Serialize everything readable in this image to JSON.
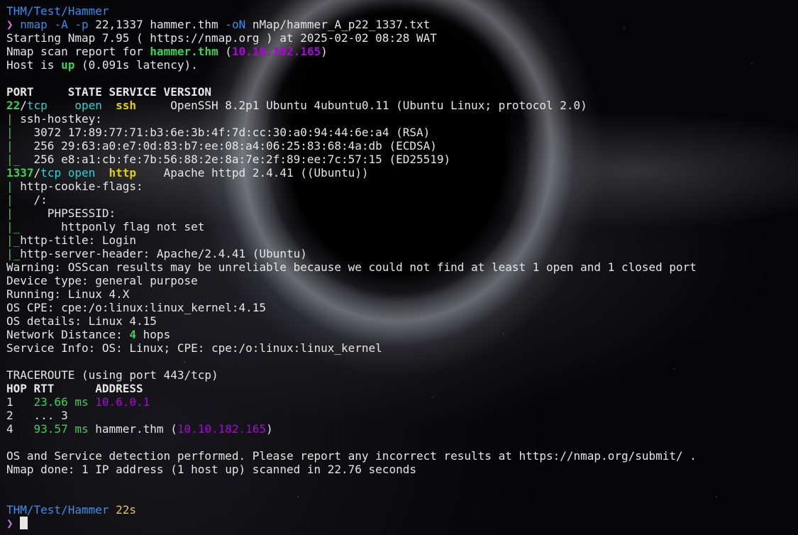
{
  "prompt_top": {
    "path": "THM/Test/Hammer",
    "symbol": "❯"
  },
  "command": {
    "exe": "nmap",
    "flag_A": "-A",
    "flag_p": "-p",
    "ports": "22,1337",
    "host": "hammer.thm",
    "flag_oN": "-oN",
    "outfile": "nMap/hammer_A_p22_1337.txt"
  },
  "output": {
    "starting": "Starting Nmap 7.95 ( https://nmap.org ) at 2025-02-02 08:28 WAT",
    "report_prefix": "Nmap scan report for ",
    "report_host": "hammer.thm",
    "report_paren_open": " (",
    "report_ip": "10.10.182.165",
    "report_paren_close": ")",
    "host_is": "Host is ",
    "host_up": "up",
    "latency": " (0.091s latency).",
    "header": "PORT     STATE SERVICE VERSION",
    "port22_num": "22",
    "port22_slash": "/",
    "port22_proto": "tcp",
    "port22_gap1": "    ",
    "port22_state": "open",
    "port22_gap2": "  ",
    "port22_service": "ssh",
    "port22_version": "     OpenSSH 8.2p1 Ubuntu 4ubuntu0.11 (Ubuntu Linux; protocol 2.0)",
    "hostkey_bar": "|",
    "hostkey_title": " ssh-hostkey: ",
    "hostkey_1_bar": "|",
    "hostkey_1": "   3072 17:89:77:71:b3:6e:3b:4f:7d:cc:30:a0:94:44:6e:a4 (RSA)",
    "hostkey_2_bar": "|",
    "hostkey_2": "   256 29:63:a0:e7:0d:83:b7:ee:08:a4:06:25:83:68:4a:db (ECDSA)",
    "hostkey_3_bar": "|_",
    "hostkey_3": "  256 e8:a1:cb:fe:7b:56:88:2e:8a:7e:2f:89:ee:7c:57:15 (ED25519)",
    "port1337_num": "1337",
    "port1337_slash": "/",
    "port1337_proto": "tcp",
    "port1337_gap1": " ",
    "port1337_state": "open",
    "port1337_gap2": "  ",
    "port1337_service": "http",
    "port1337_version": "    Apache httpd 2.4.41 ((Ubuntu))",
    "cookie_bar": "|",
    "cookie_title": " http-cookie-flags: ",
    "cookie_path_bar": "|",
    "cookie_path": "   /: ",
    "cookie_sess_bar": "|",
    "cookie_sess": "     PHPSESSID: ",
    "cookie_flag_bar": "|_",
    "cookie_flag": "      httponly flag not set",
    "title_bar": "|_",
    "title_text": "http-title: Login",
    "server_bar": "|_",
    "server_text": "http-server-header: Apache/2.4.41 (Ubuntu)",
    "warning": "Warning: OSScan results may be unreliable because we could not find at least 1 open and 1 closed port",
    "device_type": "Device type: general purpose",
    "running": "Running: Linux 4.X",
    "os_cpe": "OS CPE: cpe:/o:linux:linux_kernel:4.15",
    "os_details": "OS details: Linux 4.15",
    "distance_prefix": "Network Distance: ",
    "distance_num": "4",
    "distance_suffix": " hops",
    "service_info": "Service Info: OS: Linux; CPE: cpe:/o:linux:linux_kernel",
    "traceroute_title": "TRACEROUTE (using port 443/tcp)",
    "traceroute_header": "HOP RTT      ADDRESS",
    "hop1_num": "1   ",
    "hop1_rtt": "23.66 ms",
    "hop1_sp": " ",
    "hop1_addr": "10.6.0.1",
    "hop2": "2   ... 3",
    "hop4_num": "4   ",
    "hop4_rtt": "93.57 ms",
    "hop4_host": " hammer.thm (",
    "hop4_ip": "10.10.182.165",
    "hop4_close": ")",
    "os_detection": "OS and Service detection performed. Please report any incorrect results at https://nmap.org/submit/ .",
    "done": "Nmap done: 1 IP address (1 host up) scanned in 22.76 seconds"
  },
  "prompt_bottom": {
    "path": "THM/Test/Hammer",
    "duration": "22s",
    "symbol": "❯"
  },
  "colors": {
    "path": "#3b8eea",
    "symbol": "#c678dd",
    "ip": "#b000e0",
    "ok": "#39d353",
    "service": "#e5d100",
    "proto": "#2ad4d4"
  }
}
